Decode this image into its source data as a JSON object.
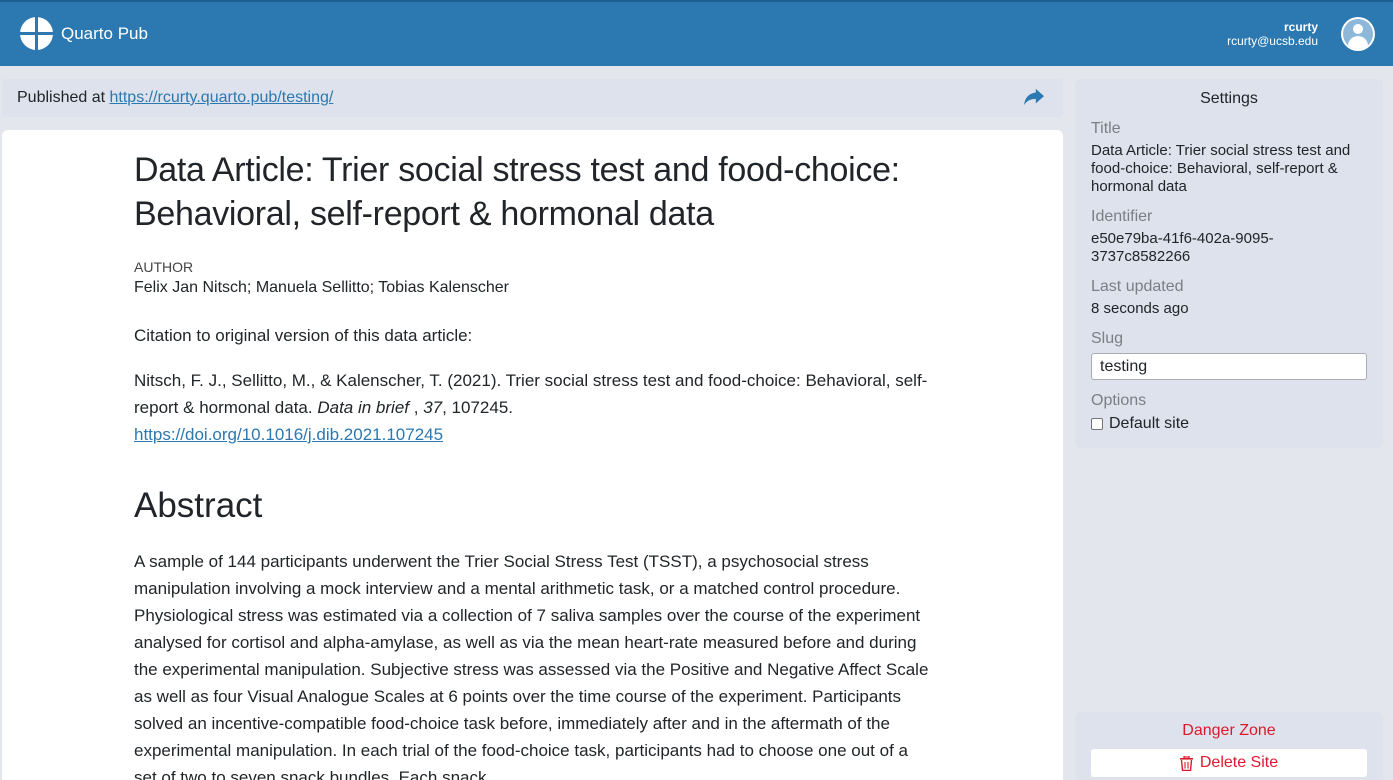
{
  "header": {
    "app_name": "Quarto Pub",
    "logo_icon": "quarto-logo-icon",
    "user_name": "rcurty",
    "user_email": "rcurty@ucsb.edu",
    "avatar_icon": "user-avatar-icon",
    "bar_color": "#2c78b0"
  },
  "publish_bar": {
    "prefix": "Published at",
    "url": "https://rcurty.quarto.pub/testing/",
    "share_icon": "share-arrow-icon"
  },
  "article": {
    "title": "Data Article: Trier social stress test and food-choice: Behavioral, self-report & hormonal data",
    "author_label": "AUTHOR",
    "authors": "Felix Jan Nitsch; Manuela Sellitto; Tobias Kalenscher",
    "citation_intro": "Citation to original version of this data article:",
    "citation_text": "Nitsch, F. J., Sellitto, M., & Kalenscher, T. (2021). Trier social stress test and food-choice: Behavioral, self-report & hormonal data.",
    "citation_journal": "Data in brief",
    "citation_sep": " , ",
    "citation_volume": "37",
    "citation_page": ", 107245.",
    "citation_doi": "https://doi.org/10.1016/j.dib.2021.107245",
    "abstract_heading": "Abstract",
    "abstract_text": "A sample of 144 participants underwent the Trier Social Stress Test (TSST), a psychosocial stress manipulation involving a mock interview and a mental arithmetic task, or a matched control procedure. Physiological stress was estimated via a collection of 7 saliva samples over the course of the experiment analysed for cortisol and alpha-amylase, as well as via the mean heart-rate measured before and during the experimental manipulation. Subjective stress was assessed via the Positive and Negative Affect Scale as well as four Visual Analogue Scales at 6 points over the time course of the experiment. Participants solved an incentive-compatible food-choice task before, immediately after and in the aftermath of the experimental manipulation. In each trial of the food-choice task, participants had to choose one out of a set of two to seven snack bundles. Each snack"
  },
  "settings": {
    "heading": "Settings",
    "title_label": "Title",
    "title_value": "Data Article: Trier social stress test and food-choice: Behavioral, self-report & hormonal data",
    "identifier_label": "Identifier",
    "identifier_value": "e50e79ba-41f6-402a-9095-3737c8582266",
    "updated_label": "Last updated",
    "updated_value": "8 seconds ago",
    "slug_label": "Slug",
    "slug_value": "testing",
    "options_label": "Options",
    "default_site_label": "Default site",
    "default_site_checked": false
  },
  "danger_zone": {
    "heading": "Danger Zone",
    "delete_label": "Delete Site",
    "trash_icon": "trash-icon",
    "color": "#dc1a2c"
  }
}
